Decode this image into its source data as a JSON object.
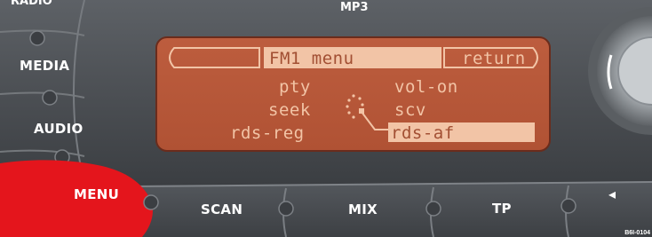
{
  "top_labels": {
    "radio": "RADIO",
    "mp3": "MP3"
  },
  "side_buttons": {
    "media": "MEDIA",
    "audio": "AUDIO",
    "menu": "MENU"
  },
  "bottom_buttons": {
    "scan": "SCAN",
    "mix": "MIX",
    "tp": "TP",
    "arrow": "◂"
  },
  "display": {
    "title": "FM1  menu",
    "return_label": "return",
    "left_column": [
      "pty",
      "seek",
      "rds-reg"
    ],
    "right_column": [
      "vol-on",
      "scv",
      "rds-af"
    ],
    "selected_item": "rds-af"
  },
  "colors": {
    "display_bg": "#b9583a",
    "display_text": "#f2c4a6",
    "menu_button": "#e4151c",
    "panel": "#4a4d52"
  },
  "icons": {
    "knob": "rotary-knob-icon",
    "rotate": "rotate-selector-icon"
  },
  "watermark": "B6I-0104"
}
